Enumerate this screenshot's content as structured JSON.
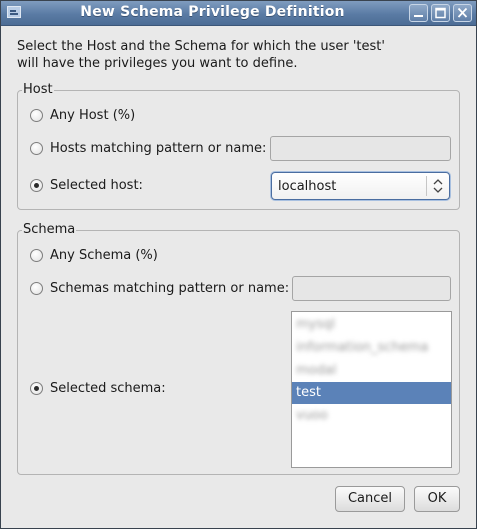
{
  "window": {
    "title": "New Schema Privilege Definition"
  },
  "intro": "Select the Host and the Schema for which the user 'test'\nwill have the privileges you want to define.",
  "host": {
    "group_label": "Host",
    "any_label": "Any Host (%)",
    "pattern_label": "Hosts matching pattern or name:",
    "pattern_value": "",
    "selected_label": "Selected host:",
    "selected_value": "localhost",
    "checked_option": "selected"
  },
  "schema": {
    "group_label": "Schema",
    "any_label": "Any Schema (%)",
    "pattern_label": "Schemas matching pattern or name:",
    "pattern_value": "",
    "selected_label": "Selected schema:",
    "checked_option": "selected",
    "list_items": [
      "mysql",
      "information_schema",
      "modal",
      "test",
      "vuoo"
    ],
    "selected_item": "test"
  },
  "buttons": {
    "cancel": "Cancel",
    "ok": "OK"
  },
  "colors": {
    "title_bar": "#5a7ba4",
    "selection": "#5b82b8",
    "dialog_bg": "#e9e9e9"
  }
}
